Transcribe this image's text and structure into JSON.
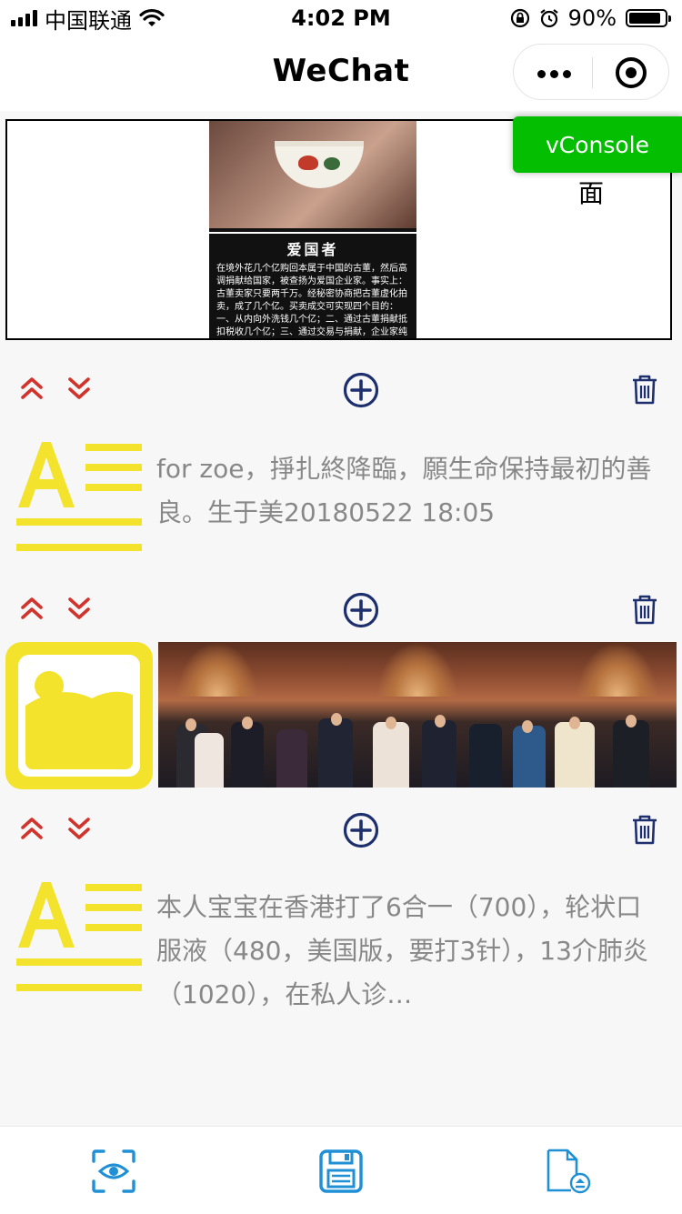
{
  "status_bar": {
    "carrier": "中国联通",
    "time": "4:02 PM",
    "battery_percent_label": "90%",
    "battery_level": 0.9
  },
  "nav": {
    "title": "WeChat",
    "more_icon": "more-dots-icon",
    "close_icon": "target-circle-icon"
  },
  "banner": {
    "heading": "爱国者",
    "body": "在境外花几个亿购回本属于中国的古董，然后高调捐献给国家，被查扬为爱国企业家。事实上：古董卖家只要两千万。经秘密协商把古董虚化拍卖，成了几个亿。买卖成交可实现四个目的：一、从内向外洗钱几个亿；二、通过古董捐献抵扣税收几个亿；三、通过交易与捐献，企业家纯赚几个亿，并成功",
    "side_text": "面"
  },
  "vconsole": {
    "label": "vConsole"
  },
  "blocks": [
    {
      "type": "text",
      "icon": "text-block-icon",
      "text": "for zoe，掙扎終降臨，願生命保持最初的善良。生于美20180522 18:05"
    },
    {
      "type": "image",
      "icon": "image-block-icon"
    },
    {
      "type": "text",
      "icon": "text-block-icon",
      "text": "本人宝宝在香港打了6合一（700），轮状口服液（480，美国版，要打3针），13介肺炎（1020），在私人诊…"
    }
  ],
  "toolbar_icons": {
    "up": "double-chevron-up-icon",
    "down": "double-chevron-down-icon",
    "add": "plus-circle-icon",
    "delete": "trash-icon"
  },
  "tab_bar": {
    "items": [
      {
        "icon": "eye-scan-icon"
      },
      {
        "icon": "save-disk-icon"
      },
      {
        "icon": "file-upload-icon"
      }
    ]
  },
  "colors": {
    "accent_red": "#d0342c",
    "icon_navy": "#1e2f6e",
    "tab_blue": "#1f8fd6",
    "block_yellow": "#f4e32c",
    "vconsole_green": "#04be02"
  }
}
